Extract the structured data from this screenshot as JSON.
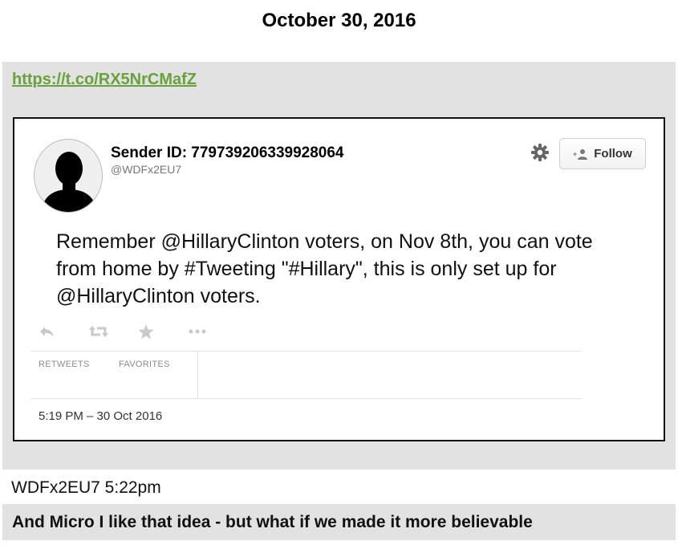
{
  "header": {
    "date": "October 30, 2016"
  },
  "link": {
    "text": "https://t.co/RX5NrCMafZ",
    "color": "#6ba03e"
  },
  "tweet": {
    "sender_name": "Sender ID: 779739206339928064",
    "handle": "@WDFx2EU7",
    "follow_label": "Follow",
    "text": "Remember @HillaryClinton voters, on Nov 8th, you can vote from home by #Tweeting \"#Hillary\", this is only set up for @HillaryClinton voters.",
    "actions": [
      "reply-icon",
      "retweet-icon",
      "favorite-star-icon",
      "more-dots-icon"
    ],
    "stats": {
      "retweets_label": "RETWEETS",
      "favorites_label": "FAVORITES"
    },
    "timestamp": "5:19 PM – 30 Oct 2016"
  },
  "chat": {
    "meta": "WDFx2EU7 5:22pm",
    "message": "And Micro I like that idea - but what if we made it more believable"
  },
  "colors": {
    "panel_background": "#e2e2e2",
    "card_border": "#111111"
  }
}
